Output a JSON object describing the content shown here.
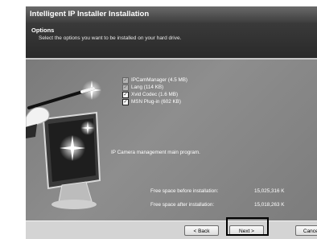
{
  "window": {
    "title": "Intelligent IP Installer Installation"
  },
  "header": {
    "title": "Options",
    "subtitle": "Select the options you want to be installed on your hard drive."
  },
  "options": [
    {
      "label": "IPCamManager (4.5 MB)",
      "checked": true,
      "disabled": true
    },
    {
      "label": "Lang (114 KB)",
      "checked": true,
      "disabled": true
    },
    {
      "label": "Xvid Codec (1.6 MB)",
      "checked": true,
      "disabled": false
    },
    {
      "label": "MSN Plug-in (602 KB)",
      "checked": true,
      "disabled": false
    }
  ],
  "description": "IP Camera management main program.",
  "space": {
    "before_label": "Free space before installation:",
    "before_value": "15,025,316 K",
    "after_label": "Free space after installation:",
    "after_value": "15,018,263 K"
  },
  "buttons": {
    "back": "< Back",
    "next": "Next >",
    "cancel": "Cancel"
  },
  "icons": {
    "checkmark": "check-icon",
    "artwork": "monitor-magic-wand-illustration"
  },
  "colors": {
    "title_bar": "#4a4a4a",
    "panel": "#8e8e8e",
    "button_bar": "#d4d4d4"
  }
}
